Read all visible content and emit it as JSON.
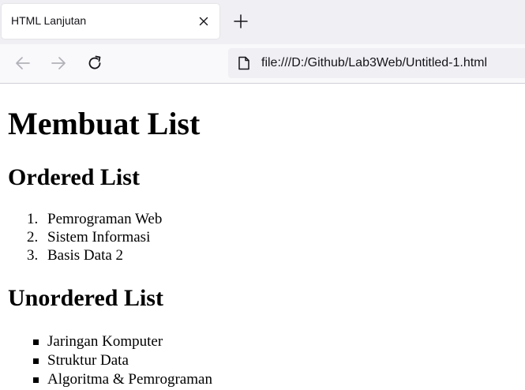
{
  "tab": {
    "title": "HTML Lanjutan",
    "close_icon": "close-icon",
    "new_tab_icon": "plus-icon"
  },
  "navigation": {
    "back_icon": "arrow-left-icon",
    "forward_icon": "arrow-right-icon",
    "reload_icon": "reload-icon",
    "url": "file:///D:/Github/Lab3Web/Untitled-1.html",
    "url_icon": "file-icon"
  },
  "page": {
    "heading": "Membuat List",
    "ordered_heading": "Ordered List",
    "ordered_items": [
      {
        "marker": "1.",
        "text": "Pemrograman Web"
      },
      {
        "marker": "2.",
        "text": "Sistem Informasi"
      },
      {
        "marker": "3.",
        "text": "Basis Data 2"
      }
    ],
    "unordered_heading": "Unordered List",
    "unordered_items": [
      {
        "text": "Jaringan Komputer"
      },
      {
        "text": "Struktur Data"
      },
      {
        "text": "Algoritma & Pemrograman"
      }
    ]
  },
  "colors": {
    "tabstrip_bg": "#f0f0f4",
    "navbar_bg": "#f9f9fb",
    "urlbar_bg": "#f0f0f4",
    "icon_active": "#15141a",
    "icon_disabled": "#b1b1b9",
    "page_text": "#000000"
  }
}
